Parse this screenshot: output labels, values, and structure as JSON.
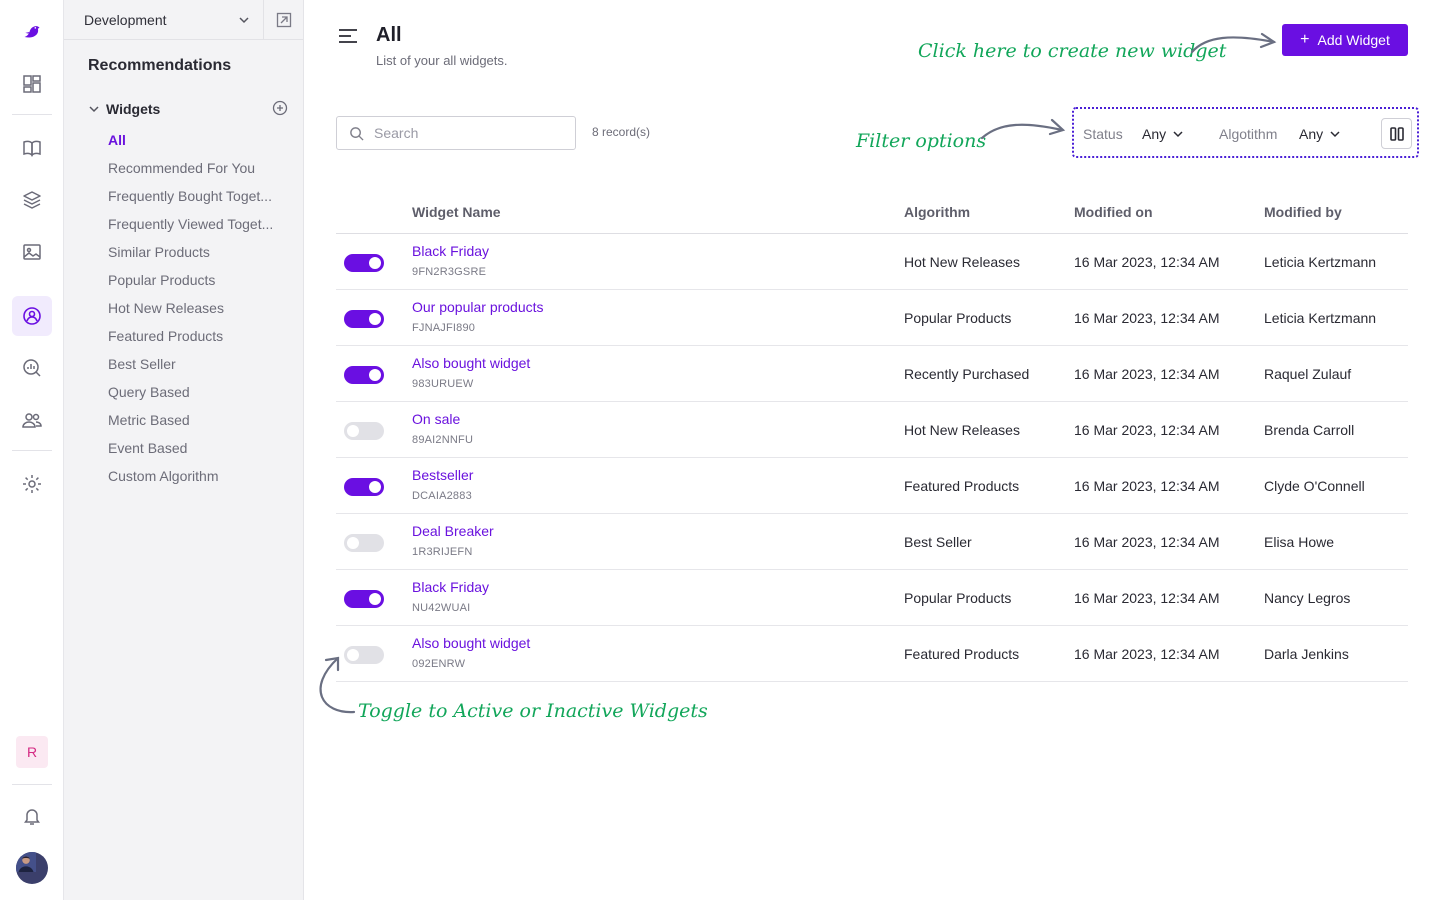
{
  "rail": {
    "icons": [
      "bird-logo-icon",
      "dashboard-icon",
      "book-icon",
      "layers-icon",
      "image-icon",
      "recommendations-icon",
      "analytics-icon",
      "users-icon",
      "settings-icon",
      "bell-icon"
    ],
    "avatar_letter": "R"
  },
  "sidebar": {
    "environment": "Development",
    "title": "Recommendations",
    "group_label": "Widgets",
    "items": [
      "All",
      "Recommended For You",
      "Frequently Bought Toget...",
      "Frequently Viewed Toget...",
      "Similar Products",
      "Popular Products",
      "Hot New Releases",
      "Featured Products",
      "Best Seller",
      "Query Based",
      "Metric Based",
      "Event Based",
      "Custom Algorithm"
    ],
    "active_index": 0
  },
  "header": {
    "title": "All",
    "subtitle": "List of your all widgets.",
    "add_button": "Add Widget"
  },
  "annotations": {
    "add": "Click here to create new widget",
    "filter": "Filter options",
    "toggle": "Toggle to Active or Inactive Widgets"
  },
  "toolbar": {
    "search_placeholder": "Search",
    "records": "8 record(s)",
    "status_label": "Status",
    "status_value": "Any",
    "algorithm_label": "Algotithm",
    "algorithm_value": "Any"
  },
  "table": {
    "columns": [
      "Widget Name",
      "Algorithm",
      "Modified on",
      "Modified by"
    ],
    "rows": [
      {
        "active": true,
        "name": "Black Friday",
        "id": "9FN2R3GSRE",
        "algorithm": "Hot New Releases",
        "modified_on": "16 Mar 2023, 12:34 AM",
        "modified_by": "Leticia Kertzmann"
      },
      {
        "active": true,
        "name": "Our popular products",
        "id": "FJNAJFI890",
        "algorithm": "Popular Products",
        "modified_on": "16 Mar 2023, 12:34 AM",
        "modified_by": "Leticia Kertzmann"
      },
      {
        "active": true,
        "name": "Also bought widget",
        "id": "983URUEW",
        "algorithm": "Recently Purchased",
        "modified_on": "16 Mar 2023, 12:34 AM",
        "modified_by": "Raquel Zulauf"
      },
      {
        "active": false,
        "name": "On sale",
        "id": "89AI2NNFU",
        "algorithm": "Hot New Releases",
        "modified_on": "16 Mar 2023, 12:34 AM",
        "modified_by": "Brenda Carroll"
      },
      {
        "active": true,
        "name": "Bestseller",
        "id": "DCAIA2883",
        "algorithm": "Featured Products",
        "modified_on": "16 Mar 2023, 12:34 AM",
        "modified_by": "Clyde O'Connell"
      },
      {
        "active": false,
        "name": "Deal Breaker",
        "id": "1R3RIJEFN",
        "algorithm": "Best Seller",
        "modified_on": "16 Mar 2023, 12:34 AM",
        "modified_by": "Elisa Howe"
      },
      {
        "active": true,
        "name": "Black Friday",
        "id": "NU42WUAI",
        "algorithm": "Popular Products",
        "modified_on": "16 Mar 2023, 12:34 AM",
        "modified_by": "Nancy Legros"
      },
      {
        "active": false,
        "name": "Also bought widget",
        "id": "092ENRW",
        "algorithm": "Featured Products",
        "modified_on": "16 Mar 2023, 12:34 AM",
        "modified_by": "Darla Jenkins"
      }
    ]
  },
  "colors": {
    "accent": "#6a0fe2",
    "annotation": "#12a65a",
    "filter_outline": "#4a1fd6",
    "toggle_off": "#e1e1e6"
  }
}
